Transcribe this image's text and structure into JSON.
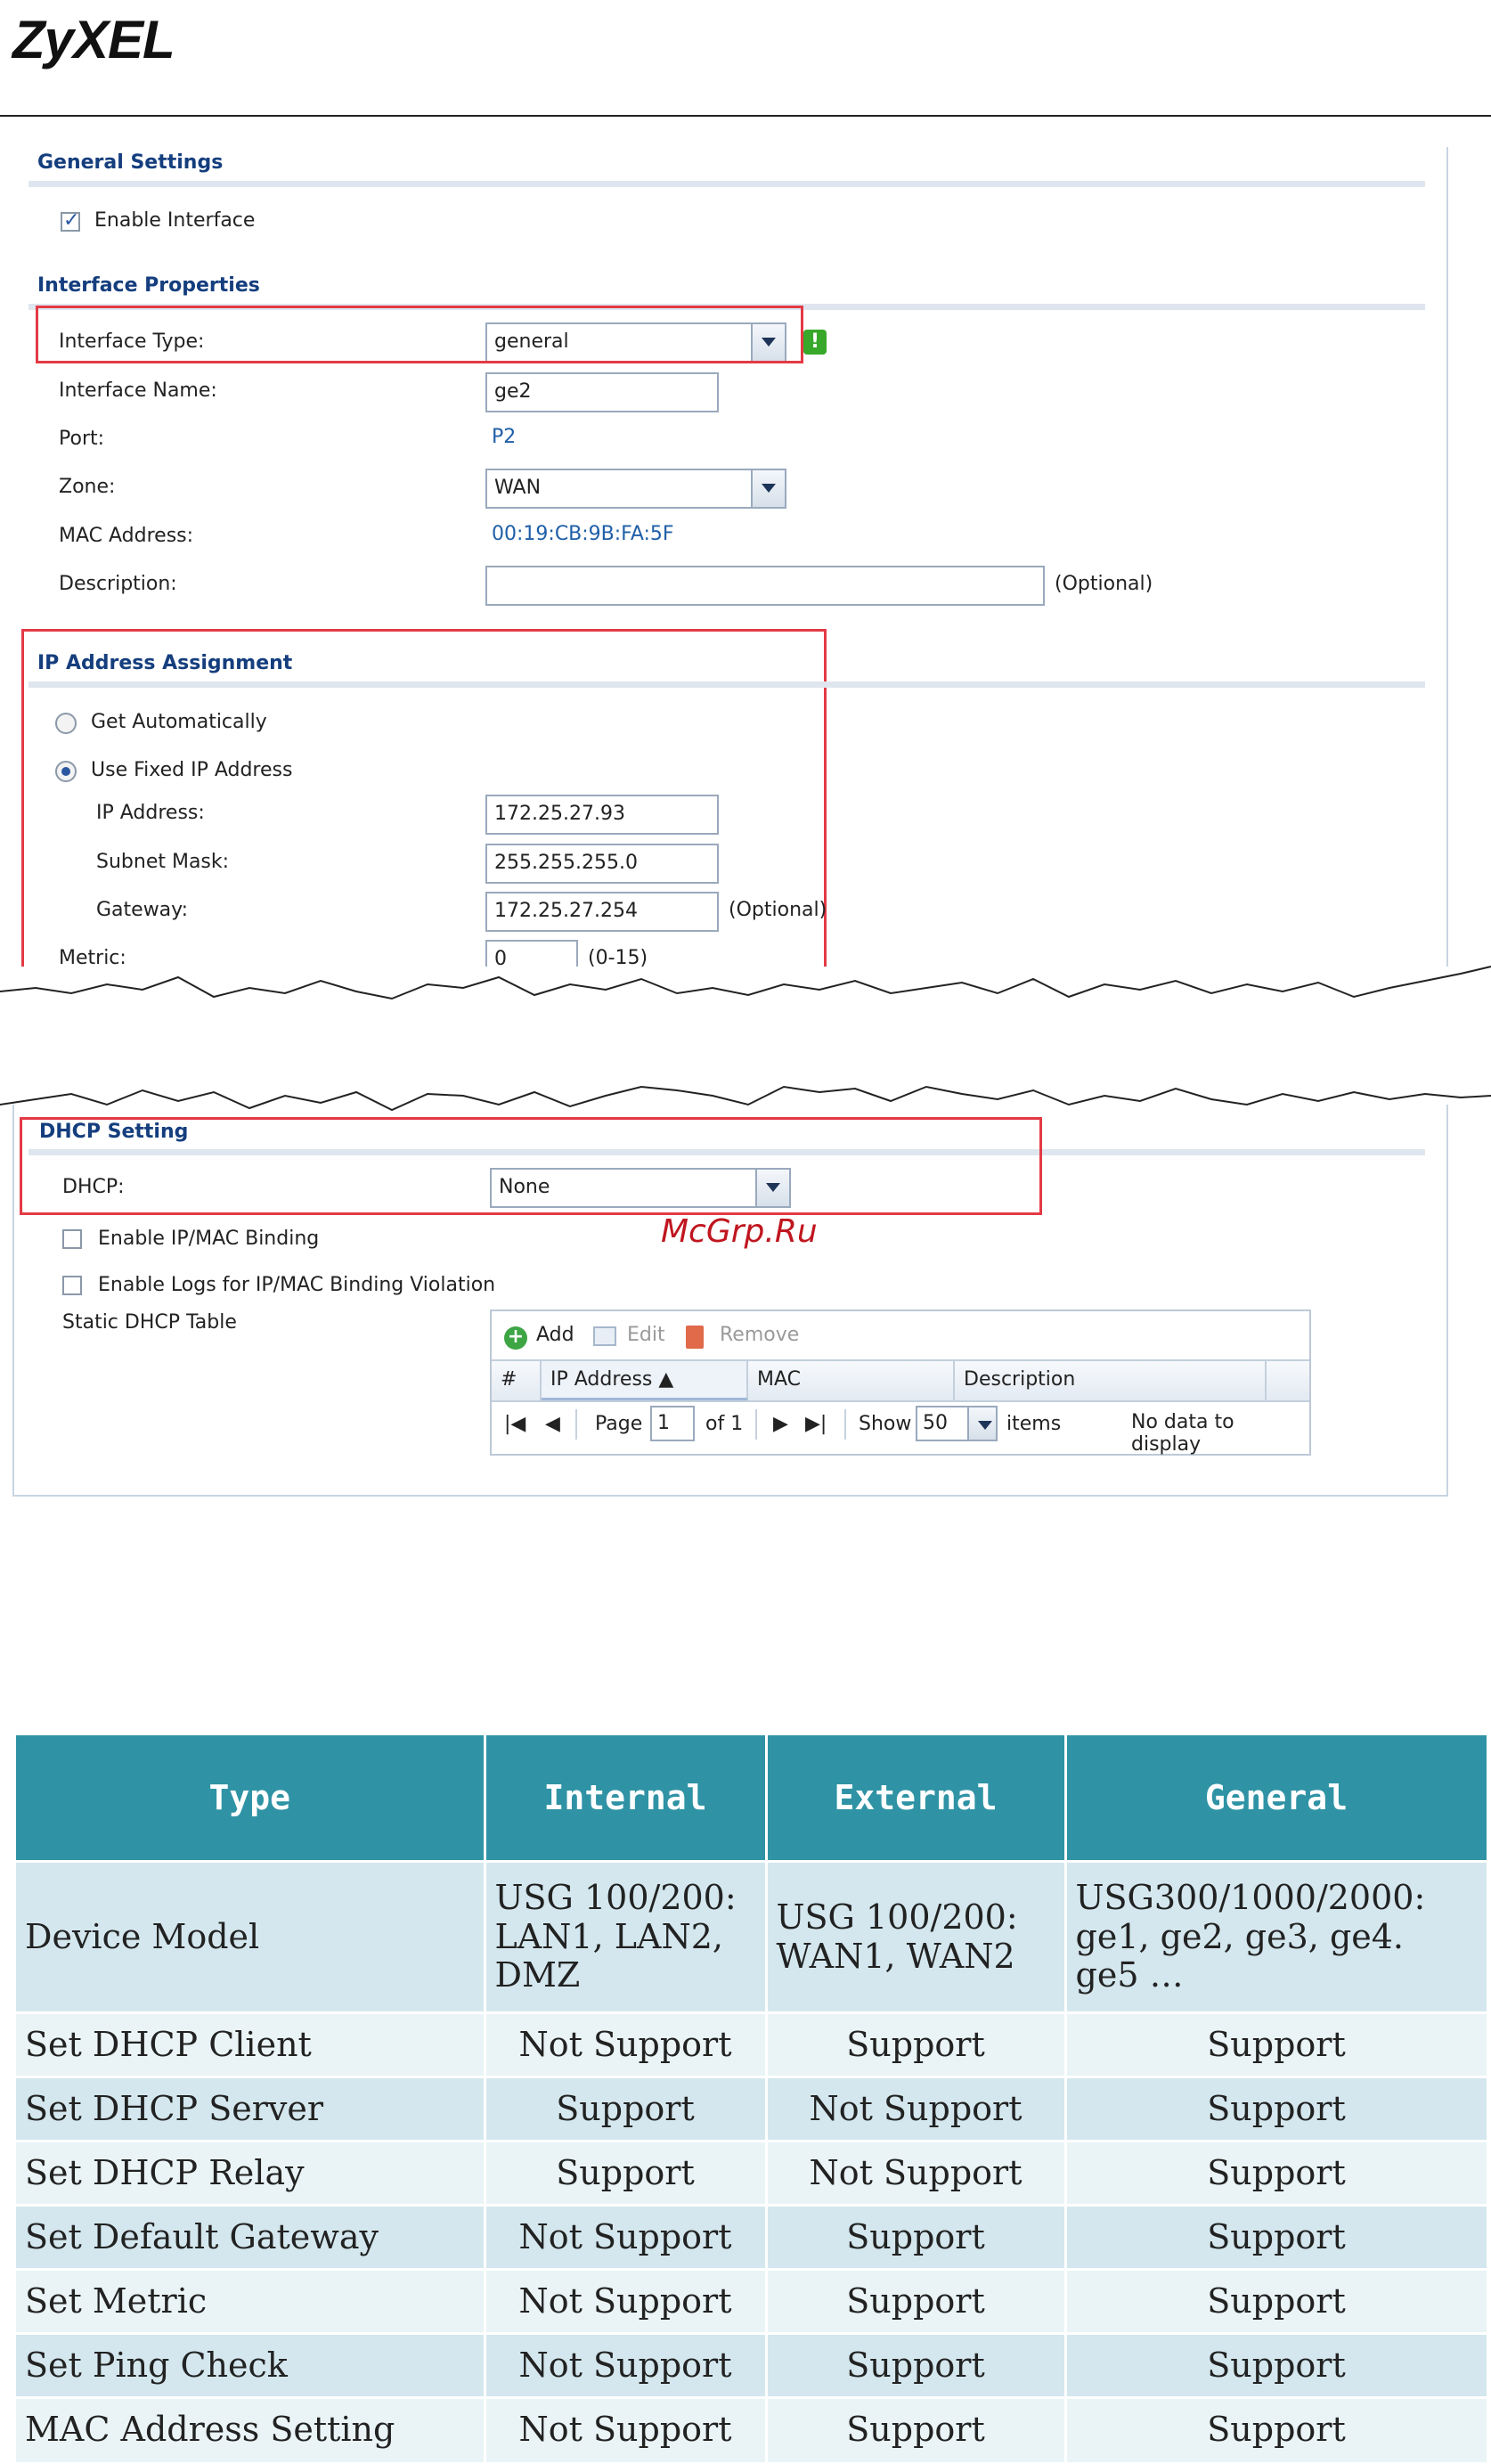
{
  "brand": "ZyXEL",
  "general": {
    "title": "General Settings",
    "enable_interface": "Enable Interface"
  },
  "iface": {
    "title": "Interface Properties",
    "type_label": "Interface Type:",
    "type_value": "general",
    "name_label": "Interface Name:",
    "name_value": "ge2",
    "port_label": "Port:",
    "port_value": "P2",
    "zone_label": "Zone:",
    "zone_value": "WAN",
    "mac_label": "MAC Address:",
    "mac_value": "00:19:CB:9B:FA:5F",
    "desc_label": "Description:",
    "desc_value": "",
    "optional": "(Optional)"
  },
  "ip": {
    "title": "IP Address Assignment",
    "get_auto": "Get Automatically",
    "use_fixed": "Use Fixed IP Address",
    "ip_label": "IP Address:",
    "ip_value": "172.25.27.93",
    "mask_label": "Subnet Mask:",
    "mask_value": "255.255.255.0",
    "gw_label": "Gateway:",
    "gw_value": "172.25.27.254",
    "gw_optional": "(Optional)",
    "metric_label": "Metric:",
    "metric_value": "0",
    "metric_range": "(0-15)"
  },
  "dhcp": {
    "title": "DHCP Setting",
    "dhcp_label": "DHCP:",
    "dhcp_value": "None",
    "ipmac_binding": "Enable IP/MAC Binding",
    "ipmac_logs": "Enable Logs for IP/MAC Binding Violation",
    "static_table": "Static DHCP Table",
    "toolbar": {
      "add": "Add",
      "edit": "Edit",
      "remove": "Remove"
    },
    "columns": {
      "num": "#",
      "ip": "IP Address ▲",
      "mac": "MAC",
      "desc": "Description"
    },
    "pager": {
      "page": "Page",
      "page_value": "1",
      "of": "of 1",
      "show": "Show",
      "show_value": "50",
      "items": "items",
      "empty": "No data to display"
    }
  },
  "watermark": "McGrp.Ru",
  "compare": {
    "headers": [
      "Type",
      "Internal",
      "External",
      "General"
    ],
    "rows": [
      [
        "Device Model",
        "USG 100/200: LAN1, LAN2, DMZ",
        "USG 100/200: WAN1, WAN2",
        "USG300/1000/2000: ge1, ge2, ge3, ge4. ge5 …"
      ],
      [
        "Set DHCP Client",
        "Not Support",
        "Support",
        "Support"
      ],
      [
        "Set DHCP Server",
        "Support",
        "Not Support",
        "Support"
      ],
      [
        "Set DHCP Relay",
        "Support",
        "Not Support",
        "Support"
      ],
      [
        "Set Default Gateway",
        "Not Support",
        "Support",
        "Support"
      ],
      [
        "Set Metric",
        "Not Support",
        "Support",
        "Support"
      ],
      [
        "Set Ping Check",
        "Not Support",
        "Support",
        "Support"
      ],
      [
        "MAC Address Setting",
        "Not Support",
        "Support",
        "Support"
      ]
    ]
  },
  "colors": {
    "section_title": "#153e7e",
    "highlight_box": "#e33a45",
    "table_header": "#2f93a5",
    "row_a": "#d4e7ee",
    "row_b": "#eaf4f6",
    "watermark": "#c0161f"
  }
}
